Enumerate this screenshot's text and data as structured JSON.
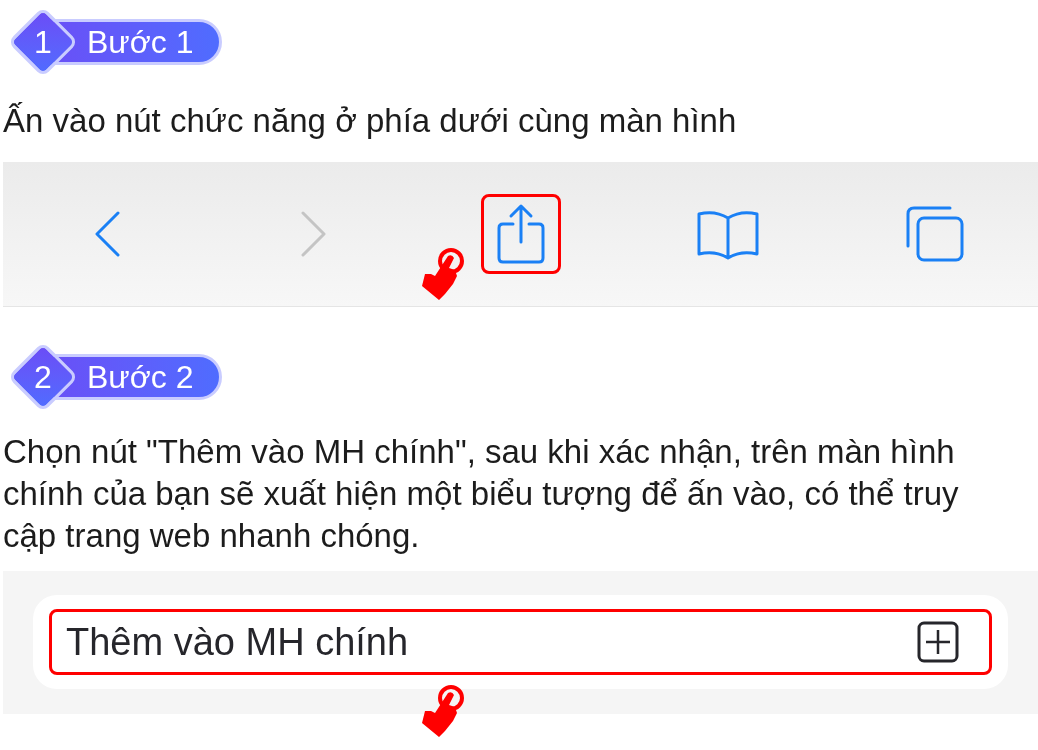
{
  "steps": [
    {
      "number": "1",
      "title": "Bước 1",
      "description": "Ấn vào nút chức năng ở phía dưới cùng màn hình",
      "illustration": {
        "kind": "toolbar",
        "buttons": [
          {
            "kind": "back",
            "disabled": false,
            "highlighted": false
          },
          {
            "kind": "forward",
            "disabled": true,
            "highlighted": false
          },
          {
            "kind": "share",
            "disabled": false,
            "highlighted": true
          },
          {
            "kind": "bookmarks",
            "disabled": false,
            "highlighted": false
          },
          {
            "kind": "tabs",
            "disabled": false,
            "highlighted": false
          }
        ]
      }
    },
    {
      "number": "2",
      "title": "Bước 2",
      "description": "Chọn nút \"Thêm vào MH chính\", sau khi xác nhận, trên màn hình chính của bạn sẽ xuất hiện một biểu tượng để ấn vào, có thể truy cập trang web nhanh chóng.",
      "illustration": {
        "kind": "menu",
        "item": {
          "label": "Thêm vào MH chính",
          "highlighted": true
        }
      }
    }
  ]
}
